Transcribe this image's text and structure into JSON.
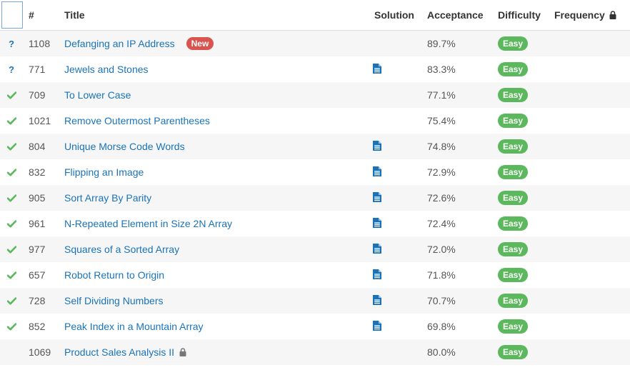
{
  "header": {
    "id_label": "#",
    "title_label": "Title",
    "solution_label": "Solution",
    "acceptance_label": "Acceptance",
    "difficulty_label": "Difficulty",
    "frequency_label": "Frequency"
  },
  "colors": {
    "link": "#1a73b8",
    "easy": "#5cb85c",
    "new_badge": "#d9534f",
    "check": "#5cb85c"
  },
  "rows": [
    {
      "status": "?",
      "id": "1108",
      "title": "Defanging an IP Address",
      "badge": "New",
      "solution": false,
      "locked": false,
      "acceptance": "89.7%",
      "difficulty": "Easy"
    },
    {
      "status": "?",
      "id": "771",
      "title": "Jewels and Stones",
      "badge": "",
      "solution": true,
      "locked": false,
      "acceptance": "83.3%",
      "difficulty": "Easy"
    },
    {
      "status": "check",
      "id": "709",
      "title": "To Lower Case",
      "badge": "",
      "solution": false,
      "locked": false,
      "acceptance": "77.1%",
      "difficulty": "Easy"
    },
    {
      "status": "check",
      "id": "1021",
      "title": "Remove Outermost Parentheses",
      "badge": "",
      "solution": false,
      "locked": false,
      "acceptance": "75.4%",
      "difficulty": "Easy"
    },
    {
      "status": "check",
      "id": "804",
      "title": "Unique Morse Code Words",
      "badge": "",
      "solution": true,
      "locked": false,
      "acceptance": "74.8%",
      "difficulty": "Easy"
    },
    {
      "status": "check",
      "id": "832",
      "title": "Flipping an Image",
      "badge": "",
      "solution": true,
      "locked": false,
      "acceptance": "72.9%",
      "difficulty": "Easy"
    },
    {
      "status": "check",
      "id": "905",
      "title": "Sort Array By Parity",
      "badge": "",
      "solution": true,
      "locked": false,
      "acceptance": "72.6%",
      "difficulty": "Easy"
    },
    {
      "status": "check",
      "id": "961",
      "title": "N-Repeated Element in Size 2N Array",
      "badge": "",
      "solution": true,
      "locked": false,
      "acceptance": "72.4%",
      "difficulty": "Easy"
    },
    {
      "status": "check",
      "id": "977",
      "title": "Squares of a Sorted Array",
      "badge": "",
      "solution": true,
      "locked": false,
      "acceptance": "72.0%",
      "difficulty": "Easy"
    },
    {
      "status": "check",
      "id": "657",
      "title": "Robot Return to Origin",
      "badge": "",
      "solution": true,
      "locked": false,
      "acceptance": "71.8%",
      "difficulty": "Easy"
    },
    {
      "status": "check",
      "id": "728",
      "title": "Self Dividing Numbers",
      "badge": "",
      "solution": true,
      "locked": false,
      "acceptance": "70.7%",
      "difficulty": "Easy"
    },
    {
      "status": "check",
      "id": "852",
      "title": "Peak Index in a Mountain Array",
      "badge": "",
      "solution": true,
      "locked": false,
      "acceptance": "69.8%",
      "difficulty": "Easy"
    },
    {
      "status": "",
      "id": "1069",
      "title": "Product Sales Analysis II",
      "badge": "",
      "solution": false,
      "locked": true,
      "acceptance": "80.0%",
      "difficulty": "Easy"
    }
  ]
}
